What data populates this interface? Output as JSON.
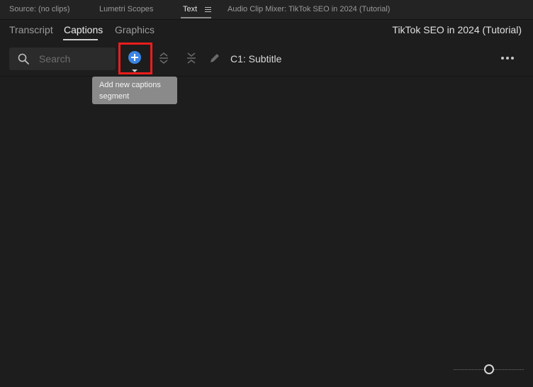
{
  "panel_tabs": [
    {
      "label": "Source: (no clips)"
    },
    {
      "label": "Lumetri Scopes"
    },
    {
      "label": "Text"
    },
    {
      "label": "Audio Clip Mixer: TikTok SEO in 2024 (Tutorial)"
    }
  ],
  "text_panel": {
    "tabs": [
      {
        "label": "Transcript"
      },
      {
        "label": "Captions"
      },
      {
        "label": "Graphics"
      }
    ],
    "active_tab": "Captions",
    "sequence_title": "TikTok SEO in 2024 (Tutorial)"
  },
  "toolbar": {
    "search_placeholder": "Search",
    "track_label": "C1: Subtitle",
    "tooltip": "Add new captions segment",
    "icons": [
      "search-icon",
      "add-captions-icon",
      "split-caption-icon",
      "merge-captions-icon",
      "pencil-icon",
      "more-icon"
    ]
  },
  "colors": {
    "accent_blue": "#3a85e6",
    "highlight_red": "#ec1c1c",
    "panel_bg": "#1d1d1d",
    "tooltip_bg": "#8a8a8a"
  }
}
